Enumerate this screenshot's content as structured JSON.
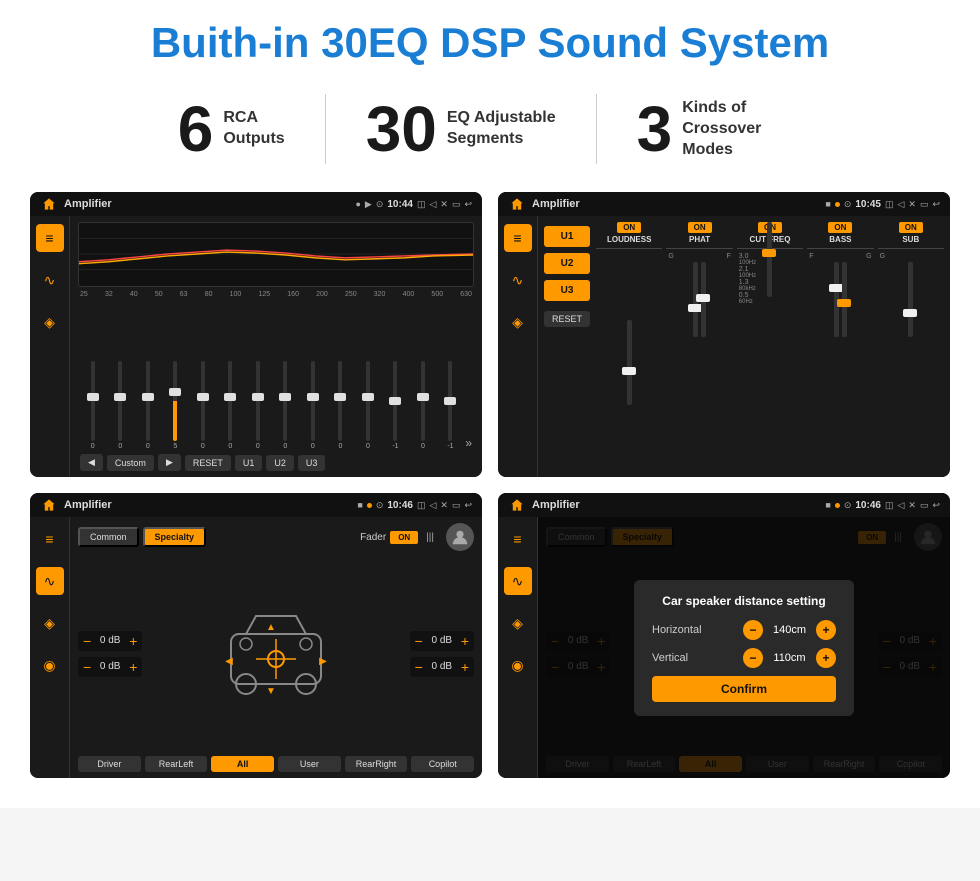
{
  "title": "Buith-in 30EQ DSP Sound System",
  "stats": [
    {
      "number": "6",
      "label": "RCA\nOutputs"
    },
    {
      "number": "30",
      "label": "EQ Adjustable\nSegments"
    },
    {
      "number": "3",
      "label": "Kinds of\nCrossover Modes"
    }
  ],
  "screens": [
    {
      "id": "eq-screen",
      "status_bar": {
        "title": "Amplifier",
        "time": "10:44",
        "icon1": "▶",
        "icon2": "●"
      },
      "type": "equalizer",
      "freq_labels": [
        "25",
        "32",
        "40",
        "50",
        "63",
        "80",
        "100",
        "125",
        "160",
        "200",
        "250",
        "320",
        "400",
        "500",
        "630"
      ],
      "slider_values": [
        "0",
        "0",
        "0",
        "5",
        "0",
        "0",
        "0",
        "0",
        "0",
        "0",
        "0",
        "-1",
        "0",
        "-1"
      ],
      "controls": [
        "◀",
        "Custom",
        "▶",
        "RESET",
        "U1",
        "U2",
        "U3"
      ]
    },
    {
      "id": "crossover-screen",
      "status_bar": {
        "title": "Amplifier",
        "time": "10:45",
        "icon1": "■",
        "icon2": "●"
      },
      "type": "crossover",
      "u_buttons": [
        "U1",
        "U2",
        "U3"
      ],
      "channels": [
        {
          "name": "LOUDNESS",
          "on": true
        },
        {
          "name": "PHAT",
          "on": true
        },
        {
          "name": "CUT FREQ",
          "on": true
        },
        {
          "name": "BASS",
          "on": true
        },
        {
          "name": "SUB",
          "on": true
        }
      ],
      "reset_label": "RESET"
    },
    {
      "id": "fader-screen",
      "status_bar": {
        "title": "Amplifier",
        "time": "10:46",
        "icon1": "■",
        "icon2": "●"
      },
      "type": "fader",
      "tabs": [
        "Common",
        "Specialty"
      ],
      "active_tab": "Specialty",
      "fader_label": "Fader",
      "fader_on": "ON",
      "left_dbs": [
        "0 dB",
        "0 dB"
      ],
      "right_dbs": [
        "0 dB",
        "0 dB"
      ],
      "bottom_btns": [
        "Driver",
        "RearLeft",
        "All",
        "User",
        "RearRight",
        "Copilot"
      ]
    },
    {
      "id": "distance-screen",
      "status_bar": {
        "title": "Amplifier",
        "time": "10:46",
        "icon1": "■",
        "icon2": "●"
      },
      "type": "distance",
      "tabs": [
        "Common",
        "Specialty"
      ],
      "active_tab": "Specialty",
      "dialog": {
        "title": "Car speaker distance setting",
        "horizontal_label": "Horizontal",
        "horizontal_value": "140cm",
        "vertical_label": "Vertical",
        "vertical_value": "110cm",
        "confirm_label": "Confirm"
      },
      "bottom_btns": [
        "Driver",
        "RearLeft",
        "All",
        "User",
        "RearRight",
        "Copilot"
      ]
    }
  ],
  "icons": {
    "home": "⌂",
    "location": "⊙",
    "camera": "◫",
    "volume": "◁",
    "screen": "▭",
    "back": "↩",
    "eq_icon": "≡",
    "wave_icon": "∿",
    "speaker_icon": "◈"
  }
}
